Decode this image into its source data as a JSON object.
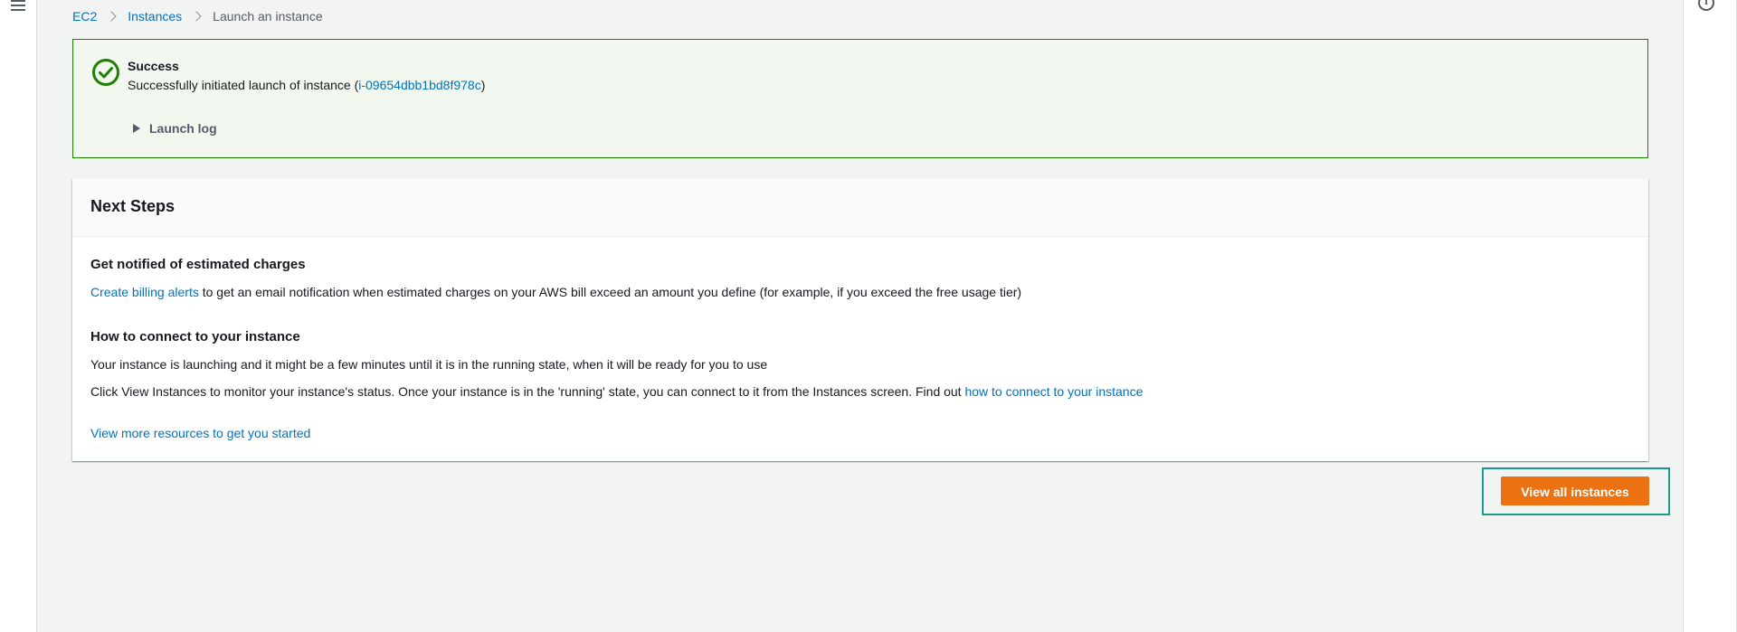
{
  "breadcrumb": {
    "items": [
      {
        "label": "EC2"
      },
      {
        "label": "Instances"
      }
    ],
    "current": "Launch an instance"
  },
  "flash": {
    "title": "Success",
    "message_prefix": "Successfully initiated launch of instance (",
    "instance_id": "i-09654dbb1bd8f978c",
    "message_suffix": ")",
    "launch_log_label": "Launch log",
    "color": "#1d8102"
  },
  "next_steps": {
    "title": "Next Steps",
    "billing": {
      "heading": "Get notified of estimated charges",
      "link": "Create billing alerts",
      "text": " to get an email notification when estimated charges on your AWS bill exceed an amount you define (for example, if you exceed the free usage tier)"
    },
    "connect": {
      "heading": "How to connect to your instance",
      "line1": "Your instance is launching and it might be a few minutes until it is in the running state, when it will be ready for you to use",
      "line2_text": "Click View Instances to monitor your instance's status. Once your instance is in the 'running' state, you can connect to it from the Instances screen. Find out ",
      "line2_link": "how to connect to your instance"
    },
    "more_resources_link": "View more resources to get you started"
  },
  "actions": {
    "view_all_label": "View all instances",
    "accent": "#ec7211"
  },
  "icons": {
    "menu": "hamburger-menu-icon",
    "info": "info-icon",
    "success": "check-circle-icon",
    "expand": "caret-right-icon"
  }
}
